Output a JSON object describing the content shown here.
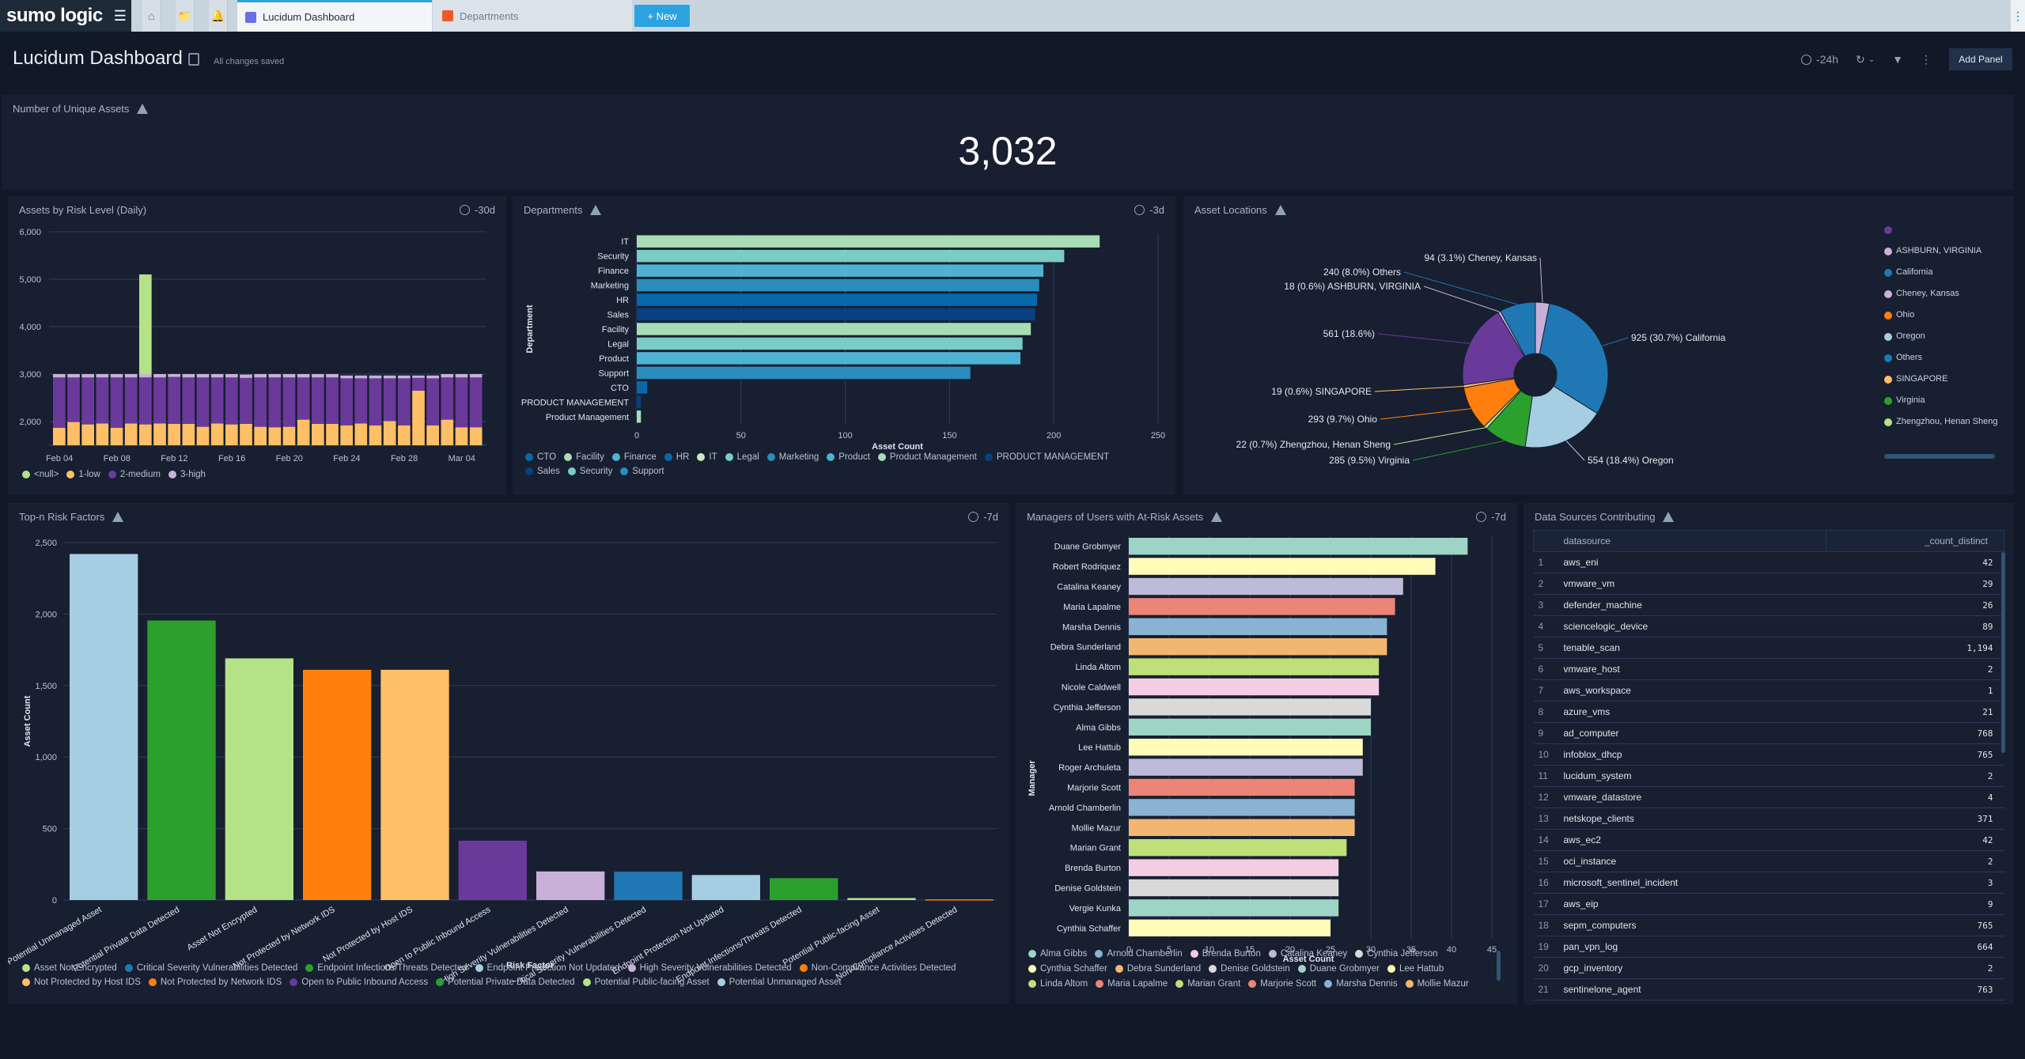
{
  "app": {
    "logo": "sumo logic",
    "tabs": [
      {
        "label": "Lucidum Dashboard",
        "active": true,
        "icon": "dashboard-icon",
        "icon_color": "#6b6ee8"
      },
      {
        "label": "Departments",
        "active": false,
        "icon": "log-search-icon",
        "icon_color": "#f05a28"
      }
    ],
    "new_button": "+ New"
  },
  "header": {
    "title": "Lucidum Dashboard",
    "status": "All changes saved",
    "time_range": "-24h",
    "add_panel": "Add Panel"
  },
  "panels": {
    "unique_assets": {
      "title": "Number of Unique Assets",
      "value": "3,032"
    },
    "risk_level": {
      "title": "Assets by Risk Level (Daily)",
      "time": "-30d"
    },
    "departments": {
      "title": "Departments",
      "time": "-3d"
    },
    "locations": {
      "title": "Asset Locations"
    },
    "risk_factors": {
      "title": "Top-n Risk Factors",
      "time": "-7d"
    },
    "managers": {
      "title": "Managers of Users with At-Risk Assets",
      "time": "-7d"
    },
    "datasources": {
      "title": "Data Sources Contributing",
      "columns": [
        "datasource",
        "_count_distinct"
      ],
      "rows": [
        [
          "1",
          "aws_eni",
          "42"
        ],
        [
          "2",
          "vmware_vm",
          "29"
        ],
        [
          "3",
          "defender_machine",
          "26"
        ],
        [
          "4",
          "sciencelogic_device",
          "89"
        ],
        [
          "5",
          "tenable_scan",
          "1,194"
        ],
        [
          "6",
          "vmware_host",
          "2"
        ],
        [
          "7",
          "aws_workspace",
          "1"
        ],
        [
          "8",
          "azure_vms",
          "21"
        ],
        [
          "9",
          "ad_computer",
          "768"
        ],
        [
          "10",
          "infoblox_dhcp",
          "765"
        ],
        [
          "11",
          "lucidum_system",
          "2"
        ],
        [
          "12",
          "vmware_datastore",
          "4"
        ],
        [
          "13",
          "netskope_clients",
          "371"
        ],
        [
          "14",
          "aws_ec2",
          "42"
        ],
        [
          "15",
          "oci_instance",
          "2"
        ],
        [
          "16",
          "microsoft_sentinel_incident",
          "3"
        ],
        [
          "17",
          "aws_eip",
          "9"
        ],
        [
          "18",
          "sepm_computers",
          "765"
        ],
        [
          "19",
          "pan_vpn_log",
          "664"
        ],
        [
          "20",
          "gcp_inventory",
          "2"
        ],
        [
          "21",
          "sentinelone_agent",
          "763"
        ]
      ]
    }
  },
  "chart_data": [
    {
      "id": "risk_level",
      "type": "bar",
      "stacked": true,
      "title": "Assets by Risk Level (Daily)",
      "ylim": [
        1500,
        6000
      ],
      "yticks": [
        2000,
        3000,
        4000,
        5000,
        6000
      ],
      "ytick_labels": [
        "2,000",
        "3,000",
        "4,000",
        "5,000",
        "6,000"
      ],
      "xtick_labels": [
        "Feb 04",
        "Feb 08",
        "Feb 12",
        "Feb 16",
        "Feb 20",
        "Feb 24",
        "Feb 28",
        "Mar 04"
      ],
      "xtick_index": [
        0,
        4,
        8,
        12,
        16,
        20,
        24,
        28
      ],
      "categories": [
        "Feb 04",
        "Feb 05",
        "Feb 06",
        "Feb 07",
        "Feb 08",
        "Feb 09",
        "Feb 10",
        "Feb 11",
        "Feb 12",
        "Feb 13",
        "Feb 14",
        "Feb 15",
        "Feb 16",
        "Feb 17",
        "Feb 18",
        "Feb 19",
        "Feb 20",
        "Feb 21",
        "Feb 22",
        "Feb 23",
        "Feb 24",
        "Feb 25",
        "Feb 26",
        "Feb 27",
        "Feb 28",
        "Mar 01",
        "Mar 02",
        "Mar 03",
        "Mar 04",
        "Mar 05"
      ],
      "series": [
        {
          "name": "1-low",
          "color": "#ffbf66",
          "values": [
            1870,
            1990,
            1940,
            1960,
            1870,
            1960,
            1940,
            1960,
            1950,
            1950,
            1890,
            1960,
            1940,
            1950,
            1890,
            1880,
            1890,
            2040,
            1950,
            1950,
            1920,
            1960,
            1920,
            2010,
            1920,
            2650,
            1920,
            2040,
            1880,
            1880
          ]
        },
        {
          "name": "2-medium",
          "color": "#6a3a9a",
          "values": [
            1060,
            940,
            990,
            970,
            1060,
            970,
            990,
            970,
            990,
            980,
            1040,
            970,
            990,
            970,
            1040,
            1050,
            1040,
            890,
            980,
            980,
            990,
            950,
            990,
            900,
            990,
            270,
            990,
            890,
            1050,
            1050
          ]
        },
        {
          "name": "3-high",
          "color": "#c9b0d8",
          "values": [
            70,
            70,
            70,
            70,
            70,
            70,
            70,
            70,
            60,
            70,
            70,
            70,
            70,
            70,
            70,
            70,
            70,
            70,
            70,
            70,
            60,
            60,
            60,
            60,
            60,
            50,
            60,
            70,
            70,
            70
          ]
        },
        {
          "name": "<null>",
          "color": "#b5e287",
          "values": [
            0,
            0,
            0,
            0,
            0,
            0,
            2100,
            0,
            0,
            0,
            0,
            0,
            0,
            0,
            0,
            0,
            0,
            0,
            0,
            0,
            0,
            0,
            0,
            0,
            0,
            0,
            0,
            0,
            0,
            0
          ]
        }
      ],
      "legend": [
        {
          "name": "<null>",
          "color": "#b5e287"
        },
        {
          "name": "1-low",
          "color": "#ffbf66"
        },
        {
          "name": "2-medium",
          "color": "#6a3a9a"
        },
        {
          "name": "3-high",
          "color": "#c9b0d8"
        }
      ]
    },
    {
      "id": "departments",
      "type": "bar",
      "orientation": "horizontal",
      "title": "Departments",
      "xlabel": "Asset Count",
      "ylabel": "Department",
      "xlim": [
        0,
        250
      ],
      "xticks": [
        0,
        50,
        100,
        150,
        200,
        250
      ],
      "categories": [
        "IT",
        "Security",
        "Finance",
        "Marketing",
        "HR",
        "Sales",
        "Facility",
        "Legal",
        "Product",
        "Support",
        "CTO",
        "PRODUCT MANAGEMENT",
        "Product Management"
      ],
      "values": [
        222,
        205,
        195,
        193,
        192,
        191,
        189,
        185,
        184,
        160,
        5,
        2,
        2
      ],
      "colors": [
        "#a8dcb5",
        "#7bccc4",
        "#4eb3d3",
        "#2b8cbe",
        "#0868ac",
        "#084081",
        "#a8dcb5",
        "#7bccc4",
        "#4eb3d3",
        "#2b8cbe",
        "#0868ac",
        "#084081",
        "#a8dcb5"
      ],
      "legend": [
        {
          "name": "CTO",
          "color": "#0868ac"
        },
        {
          "name": "Facility",
          "color": "#a8dcb5"
        },
        {
          "name": "Finance",
          "color": "#4eb3d3"
        },
        {
          "name": "HR",
          "color": "#0868ac"
        },
        {
          "name": "IT",
          "color": "#ccebc5"
        },
        {
          "name": "Legal",
          "color": "#7bccc4"
        },
        {
          "name": "Marketing",
          "color": "#2b8cbe"
        },
        {
          "name": "Product",
          "color": "#4eb3d3"
        },
        {
          "name": "Product Management",
          "color": "#a8dcb5"
        },
        {
          "name": "PRODUCT MANAGEMENT",
          "color": "#084081"
        },
        {
          "name": "Sales",
          "color": "#084081"
        },
        {
          "name": "Security",
          "color": "#7bccc4"
        },
        {
          "name": "Support",
          "color": "#2b8cbe"
        }
      ]
    },
    {
      "id": "locations",
      "type": "pie",
      "donut": true,
      "title": "Asset Locations",
      "slices": [
        {
          "label": "Cheney, Kansas",
          "value": 94,
          "pct": "3.1%",
          "color": "#c9b0d8"
        },
        {
          "label": "California",
          "value": 925,
          "pct": "30.7%",
          "color": "#1f78b4"
        },
        {
          "label": "Oregon",
          "value": 554,
          "pct": "18.4%",
          "color": "#a6cee3"
        },
        {
          "label": "Virginia",
          "value": 285,
          "pct": "9.5%",
          "color": "#2ca02c"
        },
        {
          "label": "Zhengzhou, Henan Sheng",
          "value": 22,
          "pct": "0.7%",
          "color": "#b5e287"
        },
        {
          "label": "Ohio",
          "value": 293,
          "pct": "9.7%",
          "color": "#ff7f0e"
        },
        {
          "label": "SINGAPORE",
          "value": 19,
          "pct": "0.6%",
          "color": "#ffbf66"
        },
        {
          "label": "",
          "value": 561,
          "pct": "18.6%",
          "color": "#6a3a9a"
        },
        {
          "label": "ASHBURN, VIRGINIA",
          "value": 18,
          "pct": "0.6%",
          "color": "#c9b0d8"
        },
        {
          "label": "Others",
          "value": 240,
          "pct": "8.0%",
          "color": "#1f78b4"
        }
      ],
      "legend": [
        {
          "name": "",
          "color": "#6a3a9a"
        },
        {
          "name": "ASHBURN, VIRGINIA",
          "color": "#c9b0d8"
        },
        {
          "name": "California",
          "color": "#1f78b4"
        },
        {
          "name": "Cheney, Kansas",
          "color": "#c9b0d8"
        },
        {
          "name": "Ohio",
          "color": "#ff7f0e"
        },
        {
          "name": "Oregon",
          "color": "#a6cee3"
        },
        {
          "name": "Others",
          "color": "#1f78b4"
        },
        {
          "name": "SINGAPORE",
          "color": "#ffbf66"
        },
        {
          "name": "Virginia",
          "color": "#2ca02c"
        },
        {
          "name": "Zhengzhou, Henan Sheng",
          "color": "#b5e287"
        }
      ]
    },
    {
      "id": "risk_factors",
      "type": "bar",
      "title": "Top-n Risk Factors",
      "xlabel": "Risk Factor",
      "ylabel": "Asset Count",
      "ylim": [
        0,
        2500
      ],
      "yticks": [
        0,
        500,
        1000,
        1500,
        2000,
        2500
      ],
      "ytick_labels": [
        "0",
        "500",
        "1,000",
        "1,500",
        "2,000",
        "2,500"
      ],
      "categories": [
        "Potential Unmanaged Asset",
        "Potential Private Data Detected",
        "Asset Not Encrypted",
        "Not Protected by Network IDS",
        "Not Protected by Host IDS",
        "Open to Public Inbound Access",
        "High Severity Vulnerabilities Detected",
        "Critical Severity Vulnerabilities Detected",
        "Endpoint Protection Not Updated",
        "Endpoint Infections/Threats Detected",
        "Potential Public-facing Asset",
        "Non-Compliance Activities Detected"
      ],
      "values": [
        2420,
        1955,
        1690,
        1610,
        1610,
        415,
        200,
        198,
        175,
        153,
        14,
        5
      ],
      "colors": [
        "#a6cee3",
        "#2ca02c",
        "#b5e287",
        "#ff7f0e",
        "#ffbf66",
        "#6a3a9a",
        "#c9b0d8",
        "#1f78b4",
        "#a6cee3",
        "#2ca02c",
        "#b5e287",
        "#ff7f0e"
      ],
      "legend": [
        {
          "name": "Asset Not Encrypted",
          "color": "#b5e287"
        },
        {
          "name": "Critical Severity Vulnerabilities Detected",
          "color": "#1f78b4"
        },
        {
          "name": "Endpoint Infections/Threats Detected",
          "color": "#2ca02c"
        },
        {
          "name": "Endpoint Protection Not Updated",
          "color": "#a6cee3"
        },
        {
          "name": "High Severity Vulnerabilities Detected",
          "color": "#c9b0d8"
        },
        {
          "name": "Non-Compliance Activities Detected",
          "color": "#ff7f0e"
        },
        {
          "name": "Not Protected by Host IDS",
          "color": "#ffbf66"
        },
        {
          "name": "Not Protected by Network IDS",
          "color": "#ff7f0e"
        },
        {
          "name": "Open to Public Inbound Access",
          "color": "#6a3a9a"
        },
        {
          "name": "Potential Private Data Detected",
          "color": "#2ca02c"
        },
        {
          "name": "Potential Public-facing Asset",
          "color": "#b5e287"
        },
        {
          "name": "Potential Unmanaged Asset",
          "color": "#a6cee3"
        }
      ]
    },
    {
      "id": "managers",
      "type": "bar",
      "orientation": "horizontal",
      "title": "Managers of Users with At-Risk Assets",
      "xlabel": "Asset Count",
      "ylabel": "Manager",
      "xlim": [
        0,
        45
      ],
      "xticks": [
        0,
        5,
        10,
        15,
        20,
        25,
        30,
        35,
        40,
        45
      ],
      "categories": [
        "Duane Grobmyer",
        "Robert Rodriquez",
        "Catalina Keaney",
        "Maria Lapalme",
        "Marsha Dennis",
        "Debra Sunderland",
        "Linda Altom",
        "Nicole Caldwell",
        "Cynthia Jefferson",
        "Alma Gibbs",
        "Lee Hattub",
        "Roger Archuleta",
        "Marjorie Scott",
        "Arnold Chamberlin",
        "Mollie Mazur",
        "Marian Grant",
        "Brenda Burton",
        "Denise Goldstein",
        "Vergie Kunka",
        "Cynthia Schaffer"
      ],
      "values": [
        42,
        38,
        34,
        33,
        32,
        32,
        31,
        31,
        30,
        30,
        29,
        29,
        28,
        28,
        28,
        27,
        26,
        26,
        26,
        25
      ],
      "colors": [
        "#9dd4c5",
        "#fffbb9",
        "#bebad9",
        "#ec8577",
        "#8ab2d2",
        "#f3b671",
        "#bfdf78",
        "#f4cde3",
        "#d9d9d9",
        "#9dd4c5",
        "#fffbb9",
        "#bebad9",
        "#ec8577",
        "#8ab2d2",
        "#f3b671",
        "#bfdf78",
        "#f4cde3",
        "#d9d9d9",
        "#9dd4c5",
        "#fffbb9"
      ],
      "legend": [
        {
          "name": "Alma Gibbs",
          "color": "#9dd4c5"
        },
        {
          "name": "Arnold Chamberlin",
          "color": "#8ab2d2"
        },
        {
          "name": "Brenda Burton",
          "color": "#f4cde3"
        },
        {
          "name": "Catalina Keaney",
          "color": "#bebad9"
        },
        {
          "name": "Cynthia Jefferson",
          "color": "#d9d9d9"
        },
        {
          "name": "Cynthia Schaffer",
          "color": "#fffbb9"
        },
        {
          "name": "Debra Sunderland",
          "color": "#f3b671"
        },
        {
          "name": "Denise Goldstein",
          "color": "#d9d9d9"
        },
        {
          "name": "Duane Grobmyer",
          "color": "#9dd4c5"
        },
        {
          "name": "Lee Hattub",
          "color": "#fffbb9"
        },
        {
          "name": "Linda Altom",
          "color": "#bfdf78"
        },
        {
          "name": "Maria Lapalme",
          "color": "#ec8577"
        },
        {
          "name": "Marian Grant",
          "color": "#bfdf78"
        },
        {
          "name": "Marjorie Scott",
          "color": "#ec8577"
        },
        {
          "name": "Marsha Dennis",
          "color": "#8ab2d2"
        },
        {
          "name": "Mollie Mazur",
          "color": "#f3b671"
        }
      ]
    }
  ]
}
